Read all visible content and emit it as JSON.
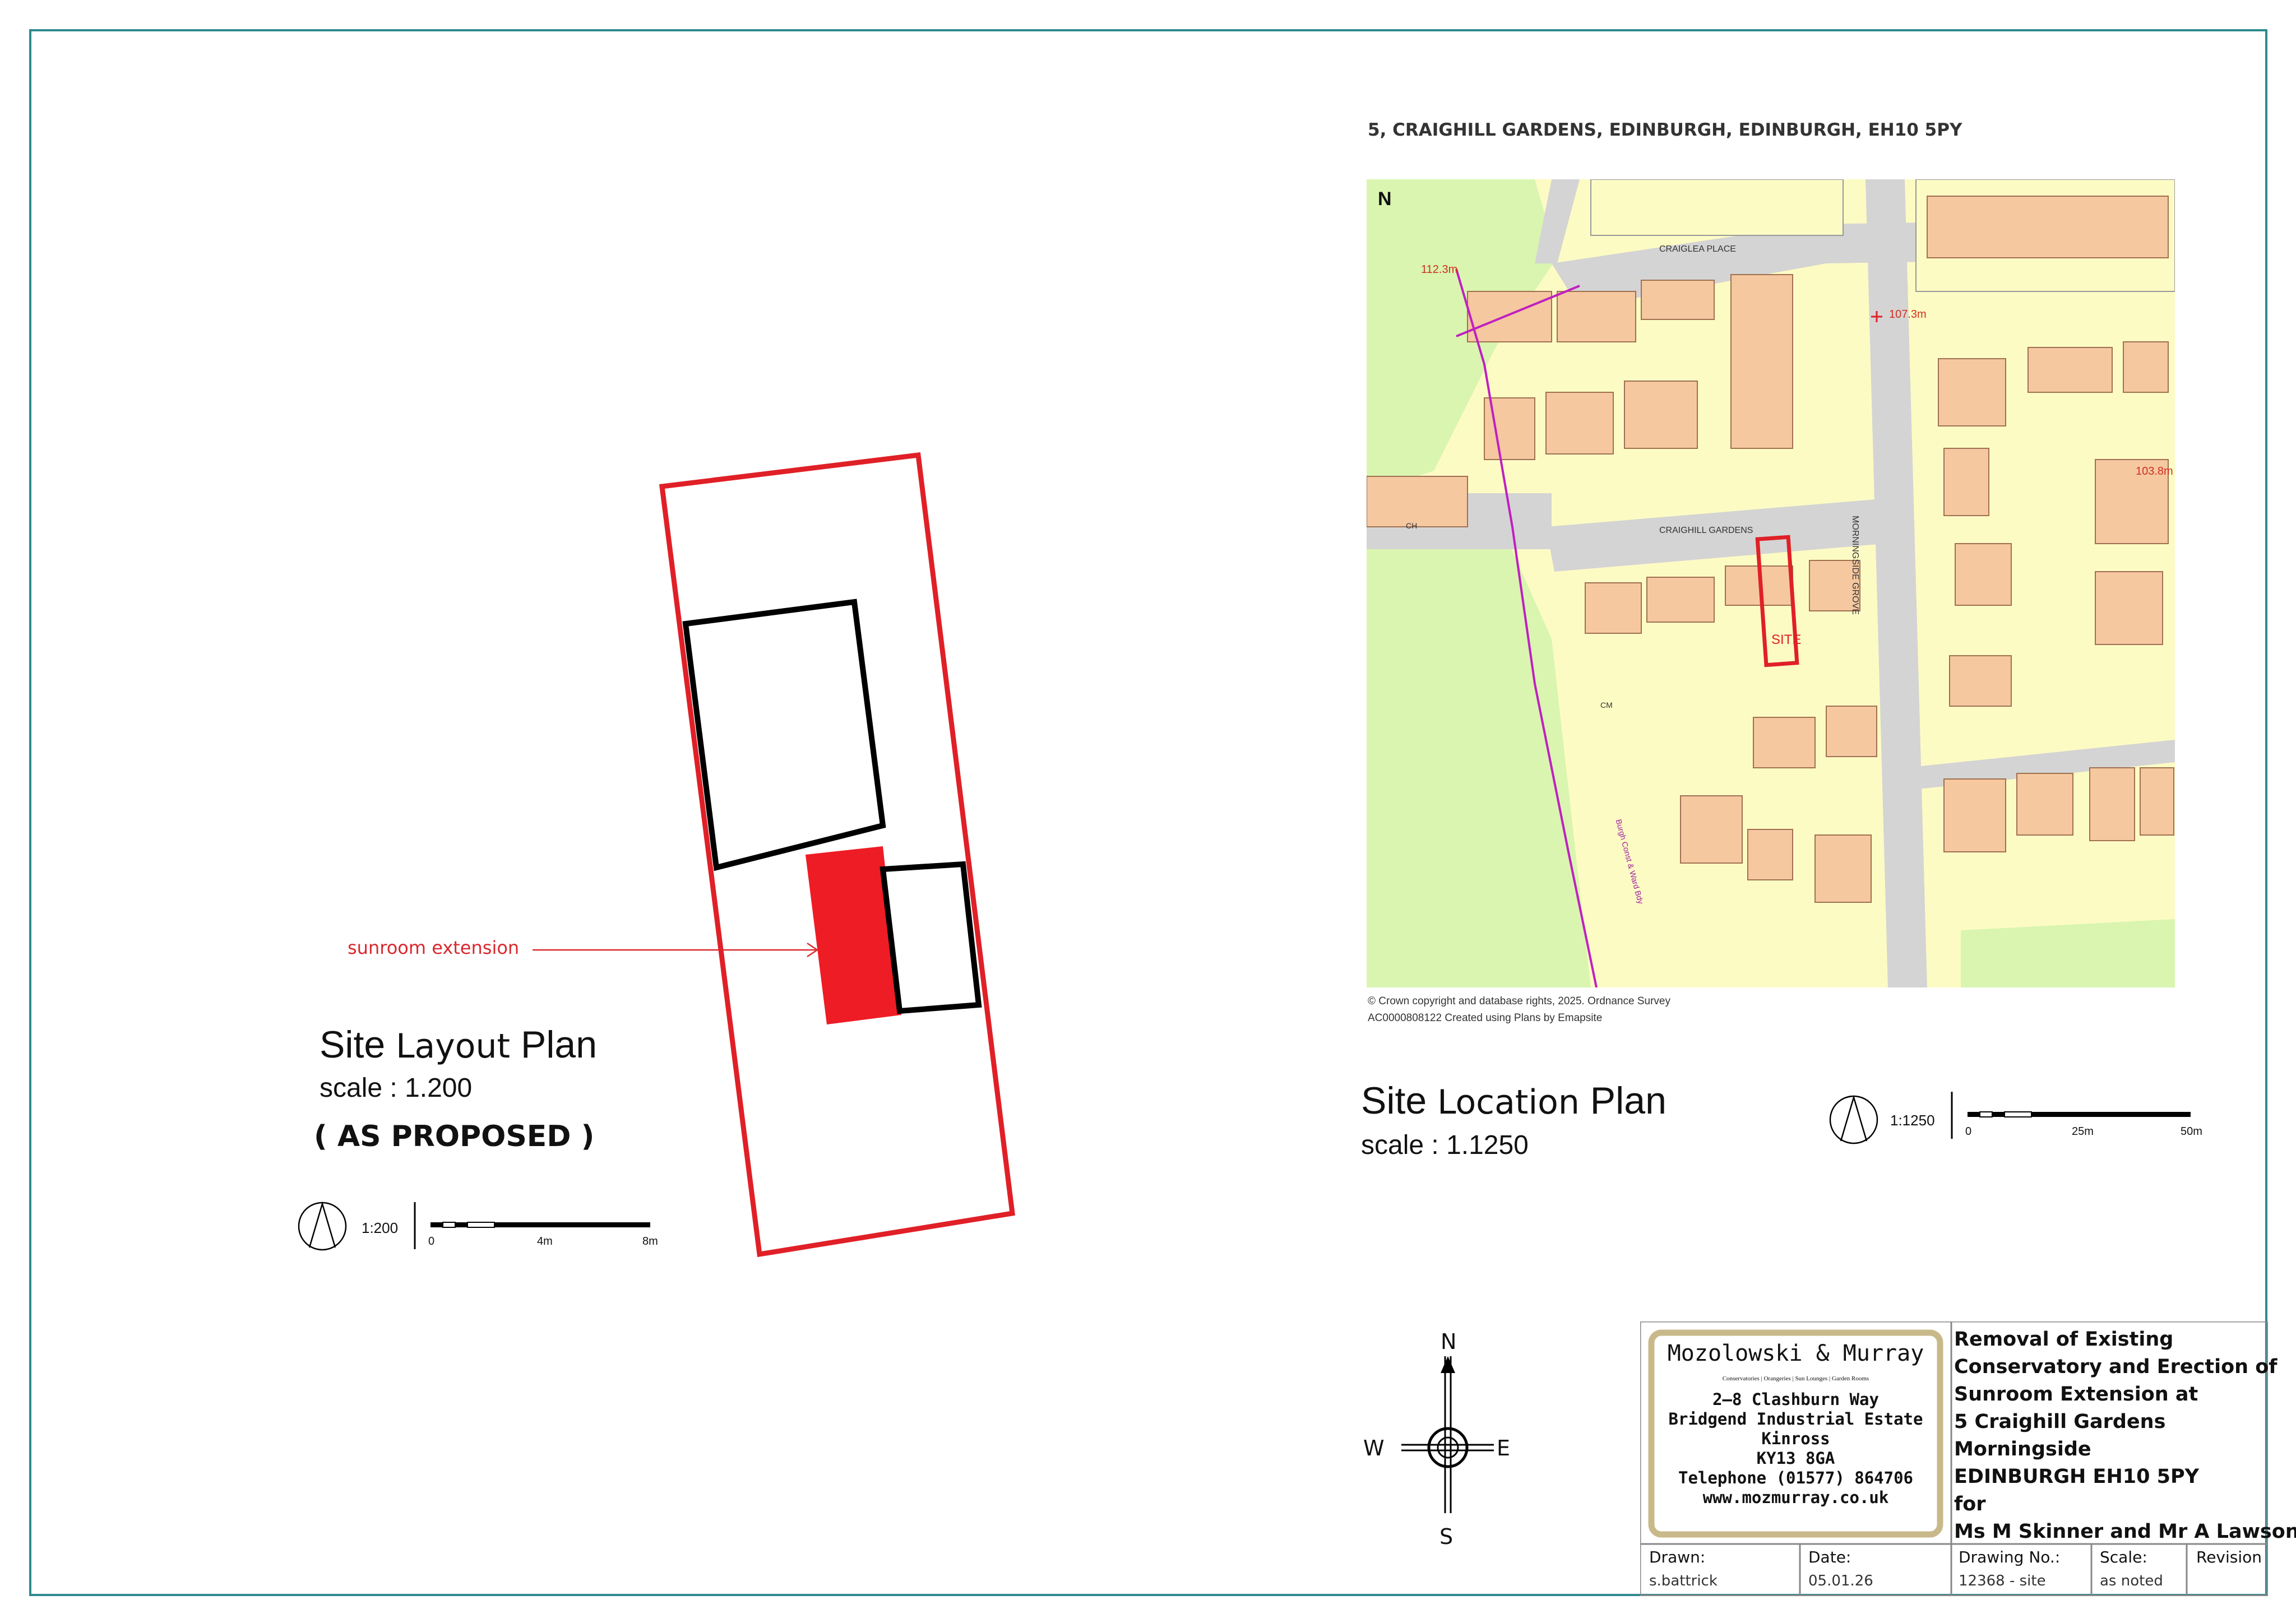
{
  "layout_plan": {
    "title_word1": "Site",
    "title_word2": "Layout",
    "title_word3": "Plan",
    "scale": "scale : 1.200",
    "status": "( AS PROPOSED )",
    "annotation": "sunroom extension",
    "scale_bar": {
      "ratio": "1:200",
      "ticks": [
        "0",
        "4m",
        "8m"
      ]
    }
  },
  "location_plan": {
    "address": "5, CRAIGHILL GARDENS, EDINBURGH, EDINBURGH, EH10 5PY",
    "title_word1": "Site",
    "title_word2": "Location",
    "title_word3": "Plan",
    "scale": "scale : 1.1250",
    "scale_bar": {
      "ratio": "1:1250",
      "ticks": [
        "0",
        "25m",
        "50m"
      ]
    },
    "copyright_line1": "© Crown copyright and database rights, 2025. Ordnance Survey",
    "copyright_line2": "AC0000808122 Created using Plans by Emapsite",
    "map_labels": {
      "north": "N",
      "site": "SITE",
      "street1": "CRAIGLEA PLACE",
      "street2": "CRAIGHILL GARDENS",
      "street3": "MORNINGSIDE GROVE",
      "spot1": "112.3m",
      "spot2": "107.3m",
      "spot3": "103.8m",
      "path": "Burgh Const & Ward Bdy",
      "cm": "CM",
      "ch": "CH"
    }
  },
  "compass": {
    "n": "N",
    "s": "S",
    "e": "E",
    "w": "W"
  },
  "title_block": {
    "company_name": "Mozolowski  &  Murray",
    "company_tagline": "Conservatories | Orangeries | Sun Lounges | Garden Rooms",
    "address_lines": [
      "2—8  Clashburn  Way",
      "Bridgend  Industrial  Estate",
      "Kinross",
      "KY13  8GA",
      "Telephone  (01577)  864706",
      "www.mozmurray.co.uk"
    ],
    "description_lines": [
      "Removal of Existing",
      "Conservatory and Erection of",
      "Sunroom Extension         at",
      "5 Craighill Gardens",
      "Morningside",
      "EDINBURGH     EH10 5PY",
      "for",
      "Ms M Skinner and Mr A Lawson"
    ],
    "fields": {
      "drawn_label": "Drawn:",
      "drawn_value": "s.battrick",
      "date_label": "Date:",
      "date_value": "05.01.26",
      "drawing_no_label": "Drawing No.:",
      "drawing_no_value": "12368 - site",
      "scale_label": "Scale:",
      "scale_value": "as noted",
      "revision_label": "Revision"
    }
  },
  "colors": {
    "boundary": "#e02027",
    "extension": "#ee1c25",
    "frame": "#2e8b90",
    "map_green": "#d9f5b0",
    "map_yellow": "#fdfbc4",
    "map_road": "#d4d4d4",
    "map_building": "#f5c8a0"
  }
}
